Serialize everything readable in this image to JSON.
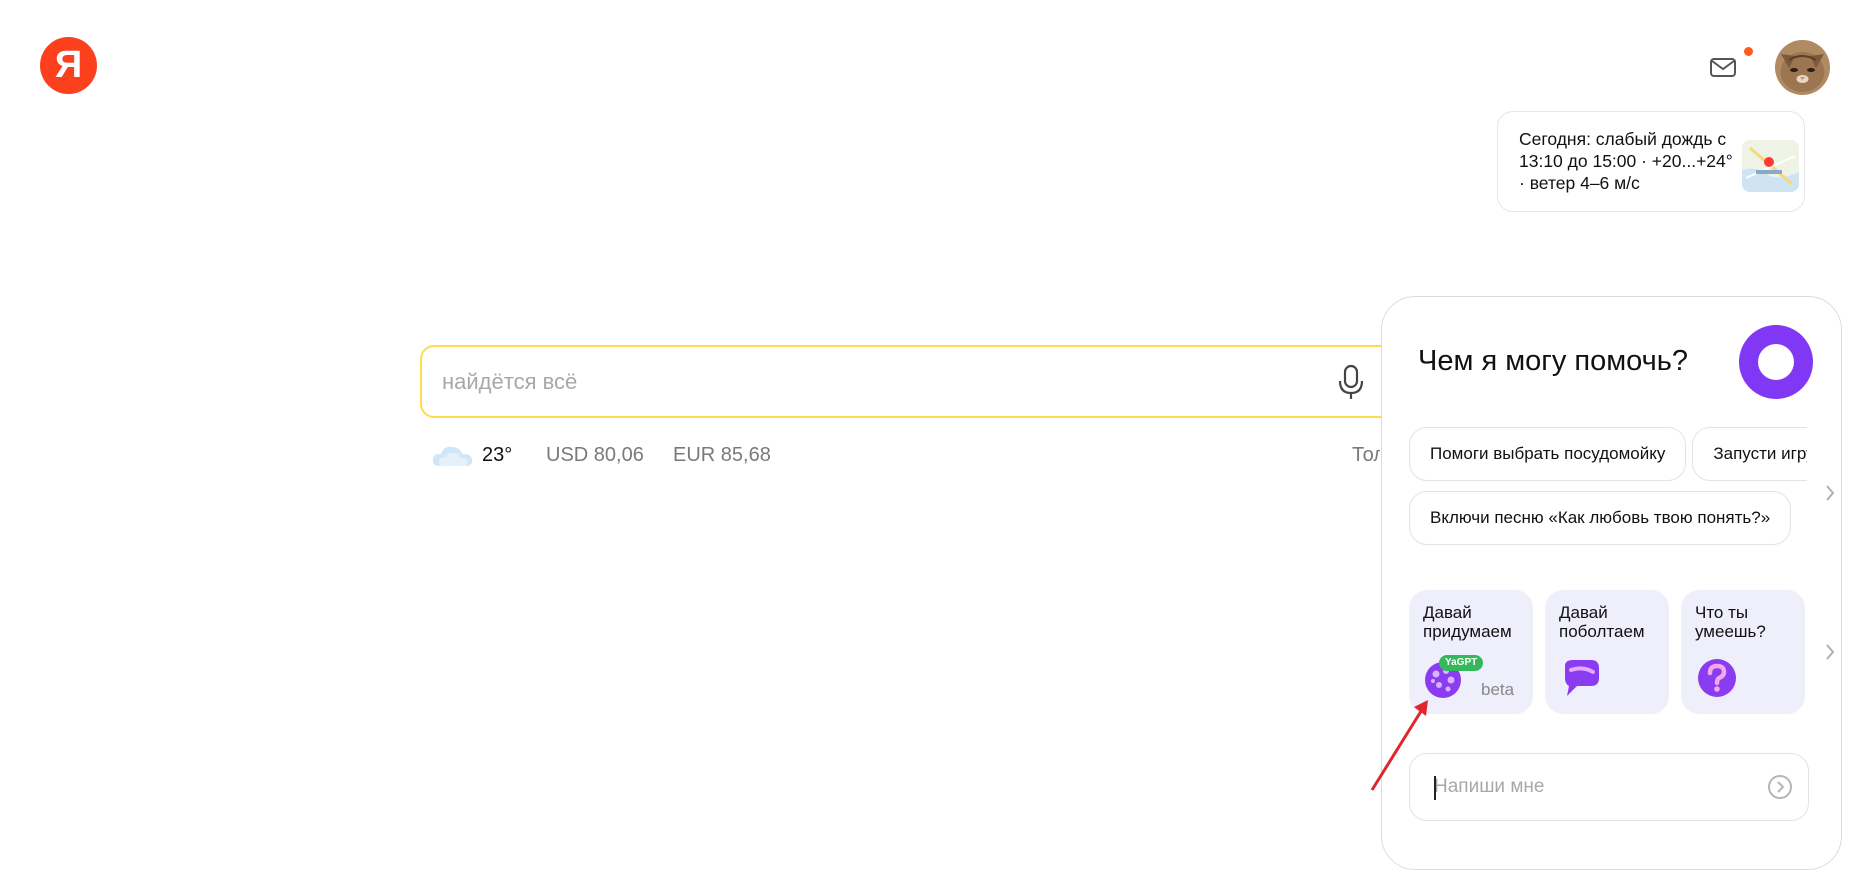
{
  "header": {
    "logo_letter": "Я",
    "mail_icon": "mail-icon",
    "avatar": "user-avatar-cat"
  },
  "weather_card": {
    "text": "Сегодня: слабый дождь с 13:10 до 15:00 · +20...+24° · ветер 4–6 м/с",
    "map_icon": "weather-map-thumbnail"
  },
  "search": {
    "placeholder": "найдётся всё",
    "value": "",
    "mic_icon": "microphone-icon"
  },
  "info_row": {
    "weather_icon": "cloud-icon",
    "temperature": "23°",
    "usd": "USD 80,06",
    "eur": "EUR 85,68",
    "cut_text": "Тол"
  },
  "assistant": {
    "title": "Чем я могу помочь?",
    "suggestions": [
      "Помоги выбрать посудомойку",
      "Запусти игру",
      "Включи песню «Как любовь твою понять?»"
    ],
    "skills": [
      {
        "label": "Давай придумаем",
        "badge": "YaGPT",
        "tag": "beta",
        "icon": "yagpt-bubble-icon"
      },
      {
        "label": "Давай поболтаем",
        "icon": "chat-bubble-icon"
      },
      {
        "label": "Что ты умеешь?",
        "icon": "question-icon"
      }
    ],
    "input_placeholder": "Напиши мне",
    "send_icon": "send-arrow-icon"
  },
  "colors": {
    "brand_red": "#fc3f1d",
    "search_border": "#ffdb4d",
    "alice_purple": "#8038f5",
    "skill_bg": "#efeefb",
    "badge_green": "#35b85c",
    "annotation_arrow": "#e0262d"
  }
}
